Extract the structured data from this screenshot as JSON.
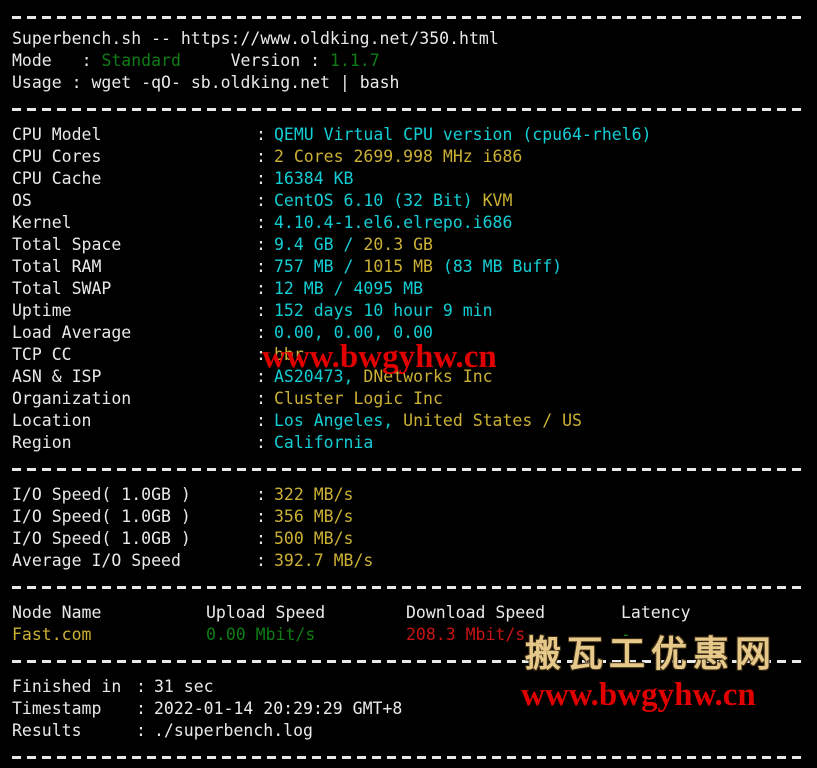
{
  "header": {
    "title": "Superbench.sh -- https://www.oldking.net/350.html",
    "mode_label": "Mode",
    "mode_colon": ":",
    "mode_value": "Standard",
    "version_label": "Version",
    "version_colon": ":",
    "version_value": "1.1.7",
    "usage_label": "Usage",
    "usage_colon": ":",
    "usage_value": "wget -qO- sb.oldking.net | bash"
  },
  "system": [
    {
      "label": "CPU Model",
      "colon": ":",
      "value_primary": "QEMU Virtual CPU version (cpu64-rhel6)",
      "value_secondary": ""
    },
    {
      "label": "CPU Cores",
      "colon": ":",
      "value_primary": "2 Cores",
      "value_secondary": "2699.998 MHz i686"
    },
    {
      "label": "CPU Cache",
      "colon": ":",
      "value_primary": "16384 KB",
      "value_secondary": ""
    },
    {
      "label": "OS",
      "colon": ":",
      "value_primary": "CentOS 6.10 (32 Bit)",
      "value_secondary": "KVM"
    },
    {
      "label": "Kernel",
      "colon": ":",
      "value_primary": "4.10.4-1.el6.elrepo.i686",
      "value_secondary": ""
    },
    {
      "label": "Total Space",
      "colon": ":",
      "value_primary": "9.4 GB /",
      "value_secondary": "20.3 GB"
    },
    {
      "label": "Total RAM",
      "colon": ":",
      "value_primary": "757 MB /",
      "value_secondary": "1015 MB",
      "value_tertiary": "(83 MB Buff)"
    },
    {
      "label": "Total SWAP",
      "colon": ":",
      "value_primary": "12 MB / 4095 MB",
      "value_secondary": ""
    },
    {
      "label": "Uptime",
      "colon": ":",
      "value_primary": "152 days 10 hour 9 min",
      "value_secondary": ""
    },
    {
      "label": "Load Average",
      "colon": ":",
      "value_primary": "0.00, 0.00, 0.00",
      "value_secondary": ""
    },
    {
      "label": "TCP CC",
      "colon": ":",
      "value_primary": "",
      "value_secondary": "bbr"
    },
    {
      "label": "ASN & ISP",
      "colon": ":",
      "value_primary": "AS20473,",
      "value_secondary": "DNetworks Inc"
    },
    {
      "label": "Organization",
      "colon": ":",
      "value_primary": "",
      "value_secondary": "Cluster Logic Inc"
    },
    {
      "label": "Location",
      "colon": ":",
      "value_primary": "Los Angeles,",
      "value_secondary": "United States / US"
    },
    {
      "label": "Region",
      "colon": ":",
      "value_primary": "California",
      "value_secondary": ""
    }
  ],
  "io": [
    {
      "label": "I/O Speed( 1.0GB )",
      "colon": ":",
      "value": "322 MB/s"
    },
    {
      "label": "I/O Speed( 1.0GB )",
      "colon": ":",
      "value": "356 MB/s"
    },
    {
      "label": "I/O Speed( 1.0GB )",
      "colon": ":",
      "value": "500 MB/s"
    },
    {
      "label": "Average I/O Speed",
      "colon": ":",
      "value": "392.7 MB/s"
    }
  ],
  "speedtest": {
    "headers": [
      "Node Name",
      "Upload Speed",
      "Download Speed",
      "Latency"
    ],
    "rows": [
      {
        "node": "Fast.com",
        "upload": "0.00 Mbit/s",
        "download": "208.3 Mbit/s",
        "latency": "-"
      }
    ]
  },
  "footer": [
    {
      "label": "Finished in",
      "colon": ":",
      "value": "31 sec"
    },
    {
      "label": "Timestamp",
      "colon": ":",
      "value": "2022-01-14 20:29:29 GMT+8"
    },
    {
      "label": "Results",
      "colon": ":",
      "value": "./superbench.log"
    }
  ],
  "watermarks": {
    "middle_url": "www.bwgyhw.cn",
    "bottom_cn": "搬瓦工优惠网",
    "bottom_url": "www.bwgyhw.cn"
  },
  "colors": {
    "background": "#000000",
    "text": "#e9e9e9",
    "cyan": "#13cdd4",
    "yellow": "#cbb034",
    "green": "#0f7c15",
    "red": "#c81414",
    "watermark_red": "#e00000",
    "watermark_gold": "#e6c98a"
  }
}
